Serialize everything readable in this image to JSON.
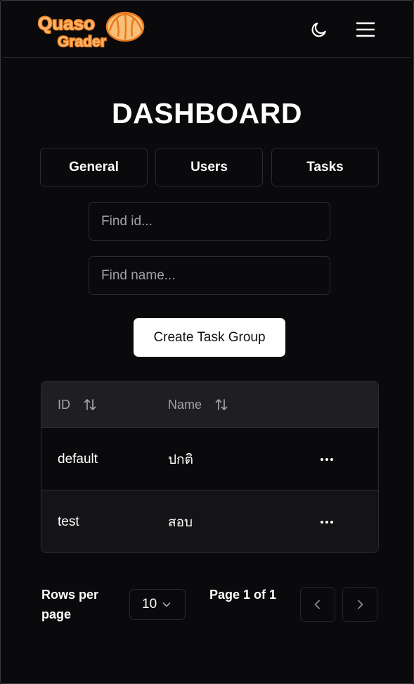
{
  "header": {
    "logo_line1": "Quaso",
    "logo_line2": "Grader",
    "icons": [
      "moon-icon",
      "menu-icon"
    ]
  },
  "page_title": "DASHBOARD",
  "tabs": [
    {
      "label": "General"
    },
    {
      "label": "Users"
    },
    {
      "label": "Tasks"
    }
  ],
  "filters": {
    "id_placeholder": "Find id...",
    "name_placeholder": "Find name..."
  },
  "create_button": "Create Task Group",
  "table": {
    "columns": [
      "ID",
      "Name"
    ],
    "rows": [
      {
        "id": "default",
        "name": "ปกติ"
      },
      {
        "id": "test",
        "name": "สอบ"
      }
    ]
  },
  "pagination": {
    "rows_per_page_label": "Rows per page",
    "rows_per_page_value": "10",
    "page_info": "Page 1 of 1"
  },
  "colors": {
    "background": "#0a0a0c",
    "logo_orange": "#f28c28",
    "header_row": "#1f1f23"
  }
}
